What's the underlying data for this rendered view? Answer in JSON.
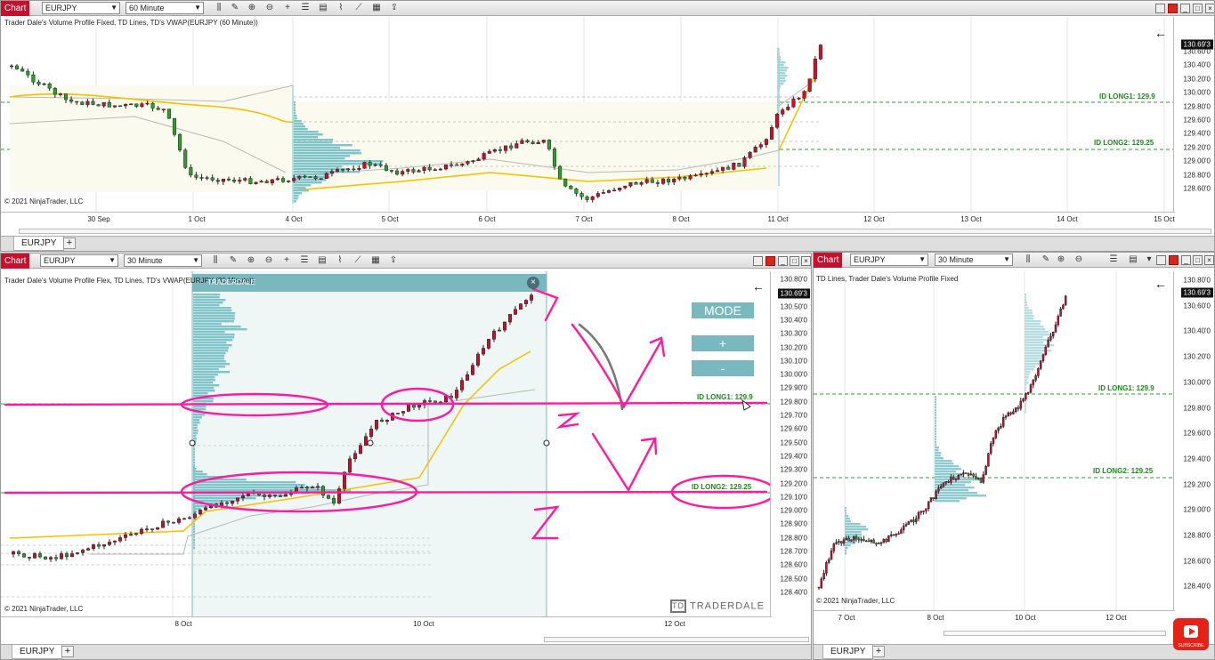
{
  "chart_btn": "Chart",
  "top": {
    "symbol": "EURJPY",
    "interval": "60 Minute",
    "title": "Trader Dale's Volume Profile Fixed, TD Lines, TD's VWAP(EURJPY (60 Minute))",
    "copyright": "© 2021 NinjaTrader, LLC",
    "tab": "EURJPY",
    "price_tag": "130.69'3",
    "id_long1": "ID LONG1: 129.9",
    "id_long2": "ID LONG2: 129.25",
    "y_labels": [
      "130.60'0",
      "130.40'0",
      "130.20'0",
      "130.00'0",
      "129.80'0",
      "129.60'0",
      "129.40'0",
      "129.20'0",
      "129.00'0",
      "128.80'0",
      "128.60'0"
    ],
    "x_labels": [
      "30 Sep",
      "1 Oct",
      "4 Oct",
      "5 Oct",
      "6 Oct",
      "7 Oct",
      "8 Oct",
      "11 Oct",
      "12 Oct",
      "13 Oct",
      "14 Oct",
      "15 Oct"
    ]
  },
  "bl": {
    "symbol": "EURJPY",
    "interval": "30 Minute",
    "title": "Trader Dale's Volume Profile Flex, TD Lines, TD's VWAP(EURJPY (30 Minute))",
    "copyright": "© 2021 NinjaTrader, LLC",
    "tab": "EURJPY",
    "price_tag": "130.69'3",
    "id_long1": "ID LONG1: 129.9",
    "id_long2": "ID LONG2: 129.25",
    "panel_label": "TRADERDALE",
    "mode": "MODE",
    "plus": "+",
    "minus": "-",
    "logo": "TRADERDALE",
    "y_labels": [
      "130.80'0",
      "130.60'0",
      "130.50'0",
      "130.40'0",
      "130.30'0",
      "130.20'0",
      "130.10'0",
      "130.00'0",
      "129.90'0",
      "129.80'0",
      "129.70'0",
      "129.60'0",
      "129.50'0",
      "129.40'0",
      "129.30'0",
      "129.20'0",
      "129.10'0",
      "129.00'0",
      "128.90'0",
      "128.80'0",
      "128.70'0",
      "128.60'0",
      "128.50'0",
      "128.40'0"
    ],
    "x_labels": [
      "8 Oct",
      "10 Oct",
      "12 Oct"
    ]
  },
  "br": {
    "symbol": "EURJPY",
    "interval": "30 Minute",
    "title": "TD Lines, Trader Dale's Volume Profile Fixed",
    "copyright": "© 2021 NinjaTrader, LLC",
    "tab": "EURJPY",
    "price_tag": "130.69'3",
    "id_long1": "ID LONG1: 129.9",
    "id_long2": "ID LONG2: 129.25",
    "y_labels": [
      "130.80'0",
      "130.60'0",
      "130.40'0",
      "130.20'0",
      "130.00'0",
      "129.80'0",
      "129.60'0",
      "129.40'0",
      "129.20'0",
      "129.00'0",
      "128.80'0",
      "128.60'0",
      "128.40'0"
    ],
    "x_labels": [
      "7 Oct",
      "8 Oct",
      "10 Oct",
      "12 Oct"
    ]
  },
  "subscribe": "SUBSCRIBE",
  "colors": {
    "chart_red": "#c8102e",
    "vp": "#7ec4c9",
    "vwap": "#f2c200",
    "green": "#1a8a1a",
    "pink": "#ff1aa0"
  }
}
